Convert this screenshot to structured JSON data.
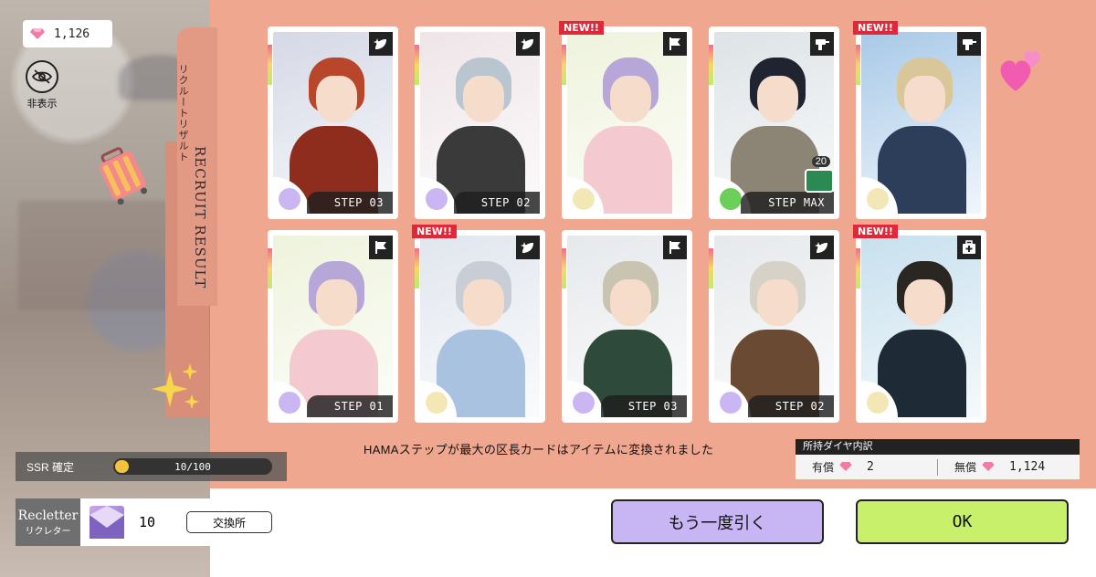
{
  "currency": {
    "amount": "1,126"
  },
  "hide_label": "非表示",
  "side_tab": {
    "title_en": "RECRUIT RESULT",
    "title_jp": "リクルートリザルト"
  },
  "cards": [
    {
      "step": "STEP 03",
      "new": "",
      "icon": "leaf-star-icon",
      "palette": {
        "bg": "#d5d8e6",
        "hair": "#b8462b",
        "body": "#8e2d1d"
      },
      "emblem": "#c9b6f2"
    },
    {
      "step": "STEP 02",
      "new": "",
      "icon": "leaf-star-icon",
      "palette": {
        "bg": "#efe5e8",
        "hair": "#b9c6cf",
        "body": "#3a3a3a"
      },
      "emblem": "#c9b6f2"
    },
    {
      "step": "",
      "new": "NEW!!",
      "icon": "flag-icon",
      "palette": {
        "bg": "#eef3dc",
        "hair": "#b7a6d8",
        "body": "#f4c9cf"
      },
      "emblem": "#f3e8b5"
    },
    {
      "step": "STEP MAX",
      "new": "",
      "icon": "drill-icon",
      "count": "20",
      "palette": {
        "bg": "#dde3e6",
        "hair": "#1f2430",
        "body": "#8c8475"
      },
      "emblem": "#6ccf5a"
    },
    {
      "step": "",
      "new": "NEW!!",
      "icon": "drill-icon",
      "palette": {
        "bg": "#a8c9e8",
        "hair": "#d9c79a",
        "body": "#2c3e5a"
      },
      "emblem": "#f3e8b5"
    },
    {
      "step": "STEP 01",
      "new": "",
      "icon": "flag-icon",
      "palette": {
        "bg": "#eef3dc",
        "hair": "#b7a6d8",
        "body": "#f4c9cf"
      },
      "emblem": "#c9b6f2"
    },
    {
      "step": "",
      "new": "NEW!!",
      "icon": "leaf-star-icon",
      "palette": {
        "bg": "#e1e6ee",
        "hair": "#c9ced6",
        "body": "#a9c2e0"
      },
      "emblem": "#f3e8b5"
    },
    {
      "step": "STEP 03",
      "new": "",
      "icon": "flag-icon",
      "palette": {
        "bg": "#e6e9ec",
        "hair": "#c9c3b2",
        "body": "#2e4a3a"
      },
      "emblem": "#c9b6f2"
    },
    {
      "step": "STEP 02",
      "new": "",
      "icon": "leaf-star-icon",
      "palette": {
        "bg": "#e6e9ec",
        "hair": "#d6d2c8",
        "body": "#6a4a32"
      },
      "emblem": "#c9b6f2"
    },
    {
      "step": "",
      "new": "NEW!!",
      "icon": "medkit-icon",
      "palette": {
        "bg": "#c7e0ee",
        "hair": "#2a2622",
        "body": "#1e2a36"
      },
      "emblem": "#f3e8b5"
    }
  ],
  "notice": "HAMAステップが最大の区長カードはアイテムに変換されました",
  "breakdown": {
    "title": "所持ダイヤ内訳",
    "paid_label": "有償",
    "paid_value": "2",
    "free_label": "無償",
    "free_value": "1,124"
  },
  "ssr": {
    "label": "SSR 確定",
    "progress_text": "10/100",
    "progress": 0.1
  },
  "recletter": {
    "name_en": "Recletter",
    "name_jp": "リクレター",
    "qty": "10",
    "exchange_label": "交換所"
  },
  "buttons": {
    "again": "もう一度引く",
    "ok": "OK"
  },
  "colors": {
    "panel": "#f0a78f",
    "again_button": "#c8b6f4",
    "ok_button": "#c8f06a",
    "new_tag": "#e0283a"
  }
}
